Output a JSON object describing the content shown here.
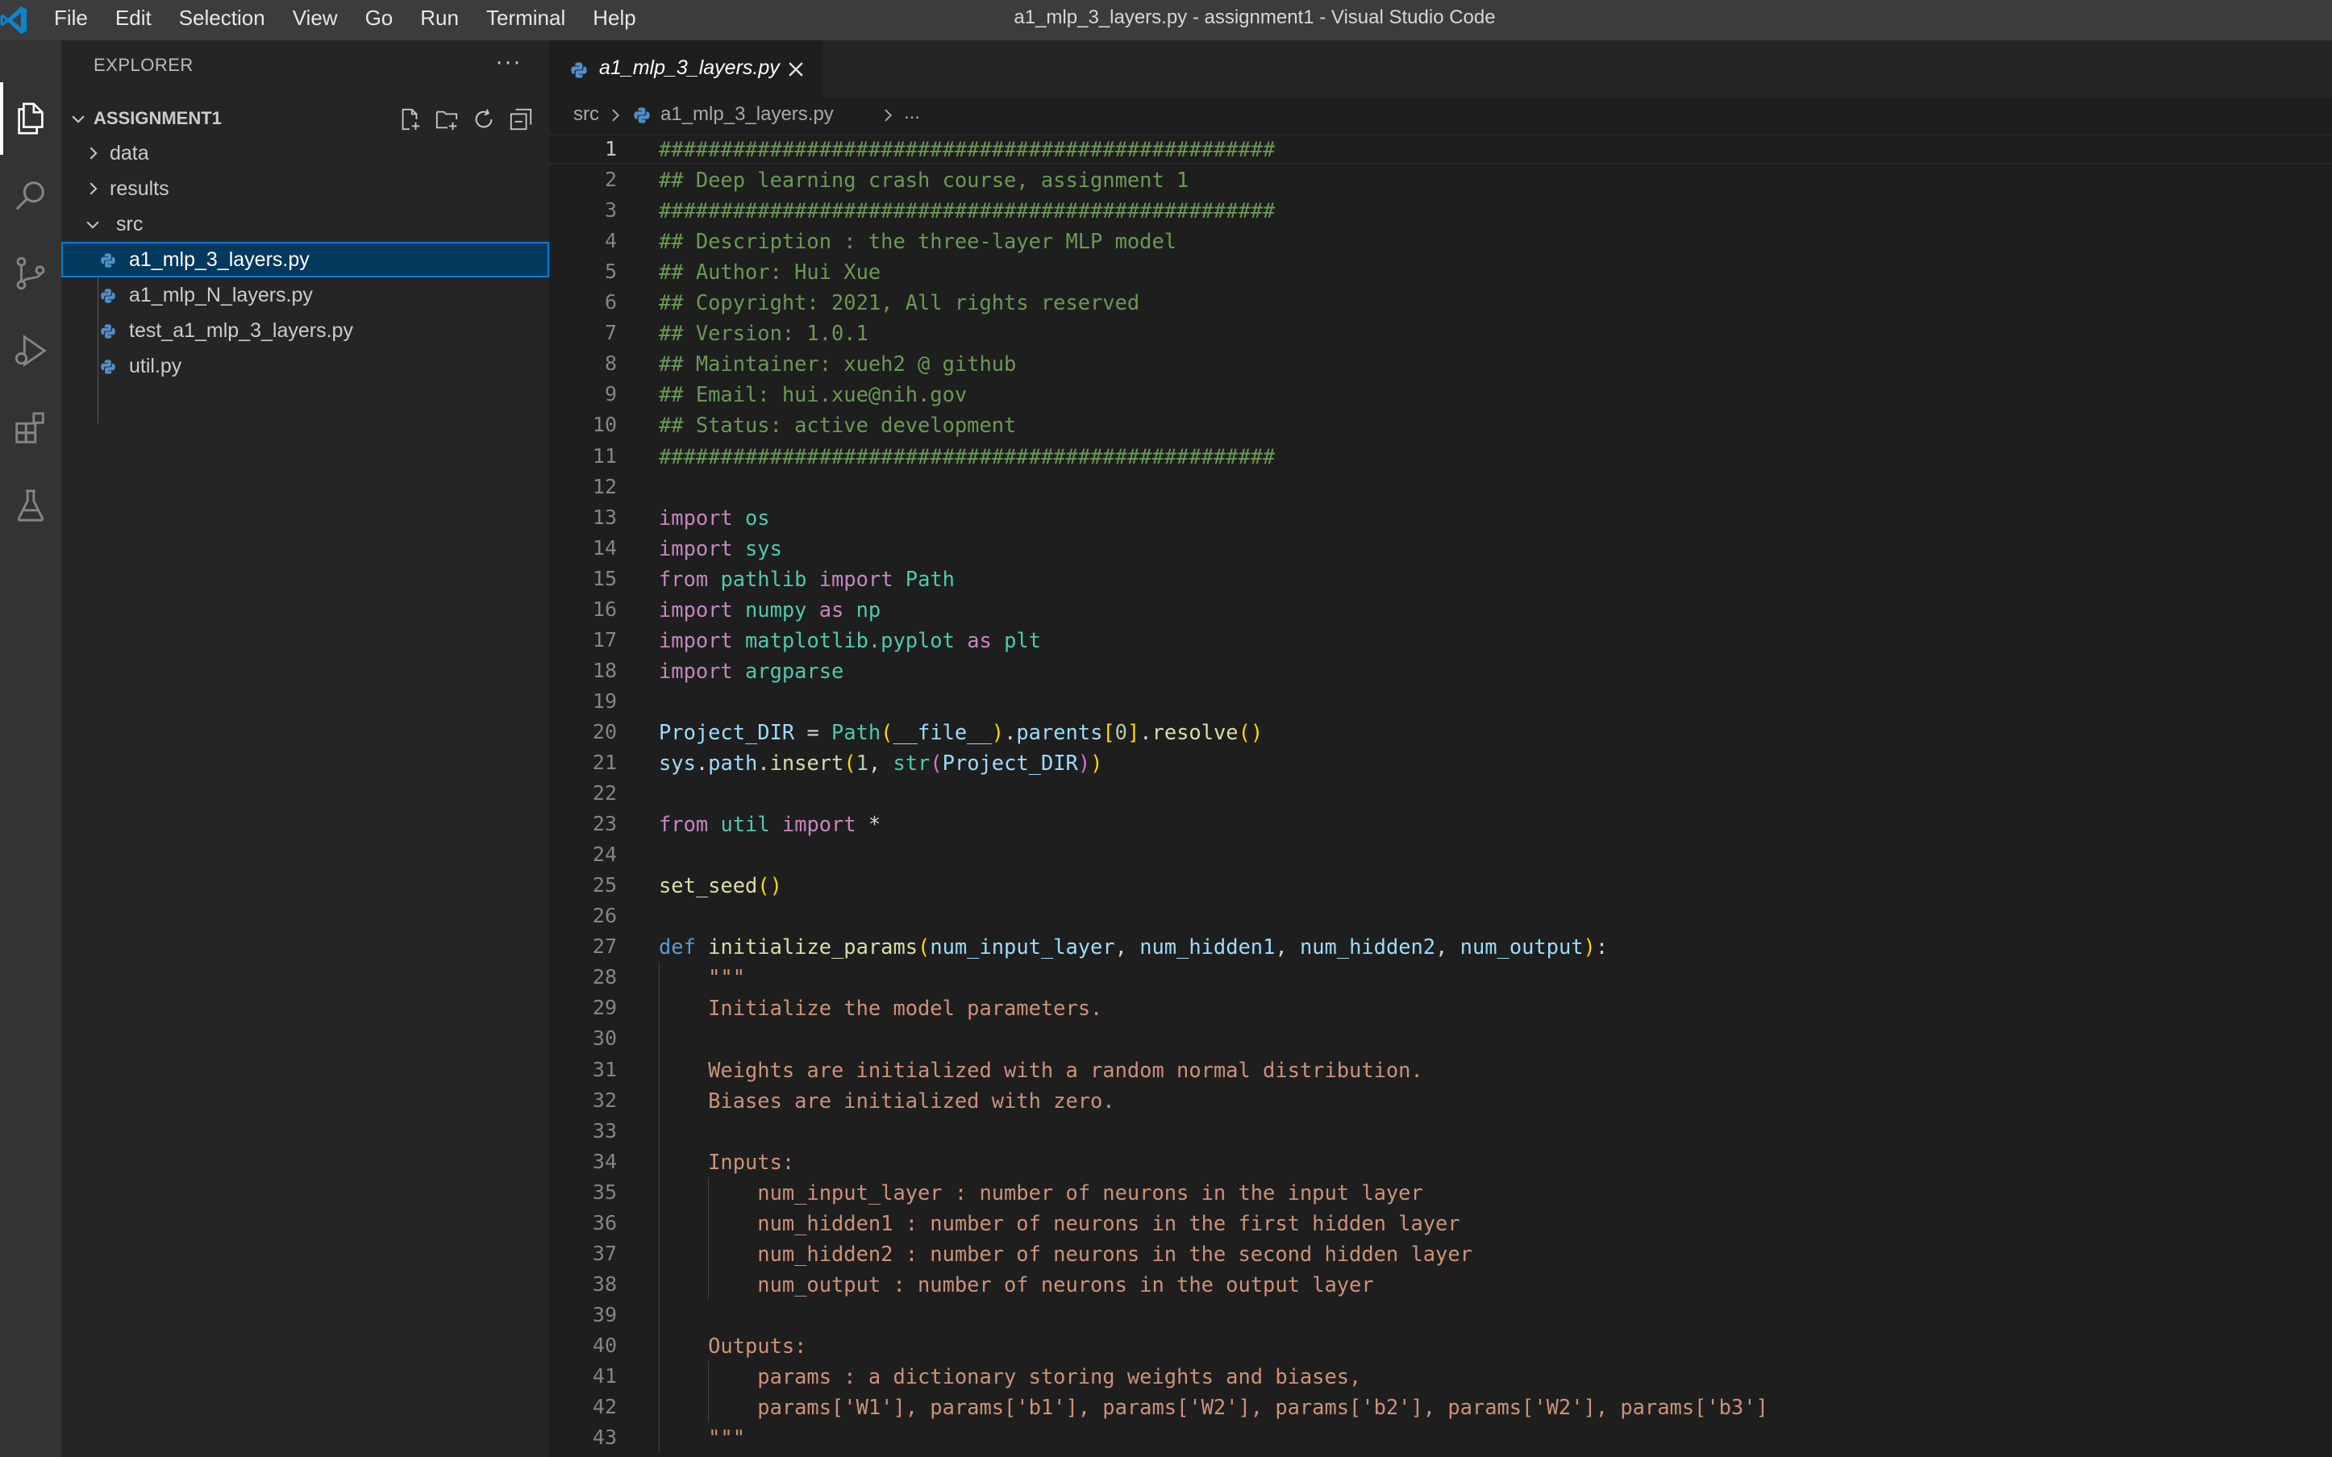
{
  "app": {
    "menu": [
      "File",
      "Edit",
      "Selection",
      "View",
      "Go",
      "Run",
      "Terminal",
      "Help"
    ],
    "window_title": "a1_mlp_3_layers.py - assignment1 - Visual Studio Code"
  },
  "activity_bar": {
    "icons": [
      "explorer-icon",
      "search-icon",
      "source-control-icon",
      "run-debug-icon",
      "extensions-icon",
      "testing-icon"
    ]
  },
  "sidebar": {
    "title": "EXPLORER",
    "more_label": "···",
    "workspace": "ASSIGNMENT1",
    "tree": [
      {
        "label": "data",
        "type": "folder",
        "expanded": false,
        "depth": 0
      },
      {
        "label": "results",
        "type": "folder",
        "expanded": false,
        "depth": 0
      },
      {
        "label": "src",
        "type": "folder",
        "expanded": true,
        "depth": 0
      },
      {
        "label": "a1_mlp_3_layers.py",
        "type": "python",
        "depth": 1,
        "selected": true
      },
      {
        "label": "a1_mlp_N_layers.py",
        "type": "python",
        "depth": 1
      },
      {
        "label": "test_a1_mlp_3_layers.py",
        "type": "python",
        "depth": 1
      },
      {
        "label": "util.py",
        "type": "python",
        "depth": 1
      }
    ]
  },
  "tabs": [
    {
      "label": "a1_mlp_3_layers.py",
      "active": true,
      "italic": true
    }
  ],
  "breadcrumb": {
    "folder": "src",
    "file": "a1_mlp_3_layers.py",
    "more": "..."
  },
  "editor": {
    "current_line": 1,
    "line_numbers": [
      "1",
      "2",
      "3",
      "4",
      "5",
      "6",
      "7",
      "8",
      "9",
      "10",
      "11",
      "12",
      "13",
      "14",
      "15",
      "16",
      "17",
      "18",
      "19",
      "20",
      "21",
      "22",
      "23",
      "24",
      "25",
      "26",
      "27",
      "28",
      "29",
      "30",
      "31",
      "32",
      "33",
      "34",
      "35",
      "36",
      "37",
      "38",
      "39",
      "40",
      "41",
      "42",
      "43"
    ],
    "lines": [
      [
        [
          "c-comment",
          "##################################################"
        ]
      ],
      [
        [
          "c-comment",
          "## Deep learning crash course, assignment 1"
        ]
      ],
      [
        [
          "c-comment",
          "##################################################"
        ]
      ],
      [
        [
          "c-comment",
          "## Description : the three-layer MLP model"
        ]
      ],
      [
        [
          "c-comment",
          "## Author: Hui Xue"
        ]
      ],
      [
        [
          "c-comment",
          "## Copyright: 2021, All rights reserved"
        ]
      ],
      [
        [
          "c-comment",
          "## Version: 1.0.1"
        ]
      ],
      [
        [
          "c-comment",
          "## Maintainer: xueh2 @ github"
        ]
      ],
      [
        [
          "c-comment",
          "## Email: hui.xue@nih.gov"
        ]
      ],
      [
        [
          "c-comment",
          "## Status: active development"
        ]
      ],
      [
        [
          "c-comment",
          "##################################################"
        ]
      ],
      [],
      [
        [
          "c-kw",
          "import"
        ],
        [
          "c-plain",
          " "
        ],
        [
          "c-mod",
          "os"
        ]
      ],
      [
        [
          "c-kw",
          "import"
        ],
        [
          "c-plain",
          " "
        ],
        [
          "c-mod",
          "sys"
        ]
      ],
      [
        [
          "c-kw",
          "from"
        ],
        [
          "c-plain",
          " "
        ],
        [
          "c-mod",
          "pathlib"
        ],
        [
          "c-plain",
          " "
        ],
        [
          "c-kw",
          "import"
        ],
        [
          "c-plain",
          " "
        ],
        [
          "c-mod",
          "Path"
        ]
      ],
      [
        [
          "c-kw",
          "import"
        ],
        [
          "c-plain",
          " "
        ],
        [
          "c-mod",
          "numpy"
        ],
        [
          "c-plain",
          " "
        ],
        [
          "c-kw",
          "as"
        ],
        [
          "c-plain",
          " "
        ],
        [
          "c-mod",
          "np"
        ]
      ],
      [
        [
          "c-kw",
          "import"
        ],
        [
          "c-plain",
          " "
        ],
        [
          "c-mod",
          "matplotlib.pyplot"
        ],
        [
          "c-plain",
          " "
        ],
        [
          "c-kw",
          "as"
        ],
        [
          "c-plain",
          " "
        ],
        [
          "c-mod",
          "plt"
        ]
      ],
      [
        [
          "c-kw",
          "import"
        ],
        [
          "c-plain",
          " "
        ],
        [
          "c-mod",
          "argparse"
        ]
      ],
      [],
      [
        [
          "c-var",
          "Project_DIR"
        ],
        [
          "c-plain",
          " = "
        ],
        [
          "c-mod",
          "Path"
        ],
        [
          "c-b1",
          "("
        ],
        [
          "c-var",
          "__file__"
        ],
        [
          "c-b1",
          ")"
        ],
        [
          "c-plain",
          "."
        ],
        [
          "c-var",
          "parents"
        ],
        [
          "c-b1",
          "["
        ],
        [
          "c-num",
          "0"
        ],
        [
          "c-b1",
          "]"
        ],
        [
          "c-plain",
          "."
        ],
        [
          "c-fn",
          "resolve"
        ],
        [
          "c-b1",
          "()"
        ]
      ],
      [
        [
          "c-var",
          "sys"
        ],
        [
          "c-plain",
          "."
        ],
        [
          "c-var",
          "path"
        ],
        [
          "c-plain",
          "."
        ],
        [
          "c-fn",
          "insert"
        ],
        [
          "c-b1",
          "("
        ],
        [
          "c-num",
          "1"
        ],
        [
          "c-plain",
          ", "
        ],
        [
          "c-mod",
          "str"
        ],
        [
          "c-b2",
          "("
        ],
        [
          "c-var",
          "Project_DIR"
        ],
        [
          "c-b2",
          ")"
        ],
        [
          "c-b1",
          ")"
        ]
      ],
      [],
      [
        [
          "c-kw",
          "from"
        ],
        [
          "c-plain",
          " "
        ],
        [
          "c-mod",
          "util"
        ],
        [
          "c-plain",
          " "
        ],
        [
          "c-kw",
          "import"
        ],
        [
          "c-plain",
          " *"
        ]
      ],
      [],
      [
        [
          "c-fn",
          "set_seed"
        ],
        [
          "c-b1",
          "()"
        ]
      ],
      [],
      [
        [
          "c-def",
          "def"
        ],
        [
          "c-plain",
          " "
        ],
        [
          "c-fn",
          "initialize_params"
        ],
        [
          "c-b1",
          "("
        ],
        [
          "c-var",
          "num_input_layer"
        ],
        [
          "c-plain",
          ", "
        ],
        [
          "c-var",
          "num_hidden1"
        ],
        [
          "c-plain",
          ", "
        ],
        [
          "c-var",
          "num_hidden2"
        ],
        [
          "c-plain",
          ", "
        ],
        [
          "c-var",
          "num_output"
        ],
        [
          "c-b1",
          ")"
        ],
        [
          "c-plain",
          ":"
        ]
      ],
      [
        [
          "c-str",
          "    \"\"\""
        ]
      ],
      [
        [
          "c-str",
          "    Initialize the model parameters."
        ]
      ],
      [],
      [
        [
          "c-str",
          "    Weights are initialized with a random normal distribution."
        ]
      ],
      [
        [
          "c-str",
          "    Biases are initialized with zero."
        ]
      ],
      [],
      [
        [
          "c-str",
          "    Inputs:"
        ]
      ],
      [
        [
          "c-str",
          "        num_input_layer : number of neurons in the input layer"
        ]
      ],
      [
        [
          "c-str",
          "        num_hidden1 : number of neurons in the first hidden layer"
        ]
      ],
      [
        [
          "c-str",
          "        num_hidden2 : number of neurons in the second hidden layer"
        ]
      ],
      [
        [
          "c-str",
          "        num_output : number of neurons in the output layer"
        ]
      ],
      [],
      [
        [
          "c-str",
          "    Outputs:"
        ]
      ],
      [
        [
          "c-str",
          "        params : a dictionary storing weights and biases,"
        ]
      ],
      [
        [
          "c-str",
          "        params['W1'], params['b1'], params['W2'], params['b2'], params['W2'], params['b3']"
        ]
      ],
      [
        [
          "c-str",
          "    \"\"\""
        ]
      ]
    ]
  }
}
